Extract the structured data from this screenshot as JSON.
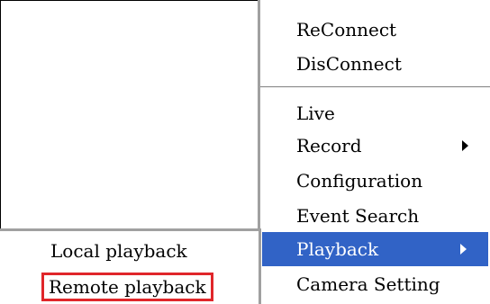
{
  "context_menu": {
    "items": [
      {
        "label": "ReConnect"
      },
      {
        "label": "DisConnect"
      },
      {
        "label": "Live"
      },
      {
        "label": "Record",
        "has_submenu": true
      },
      {
        "label": "Configuration"
      },
      {
        "label": "Event Search"
      },
      {
        "label": "Playback",
        "has_submenu": true,
        "highlighted": true
      },
      {
        "label": "Camera Setting"
      }
    ]
  },
  "playback_submenu": {
    "items": [
      {
        "label": "Local playback"
      },
      {
        "label": "Remote playback",
        "annotated": true
      }
    ]
  },
  "colors": {
    "highlight": "#3163c6",
    "annotation": "#e0262a"
  },
  "icons": {
    "submenu_arrow": "triangle-right"
  }
}
